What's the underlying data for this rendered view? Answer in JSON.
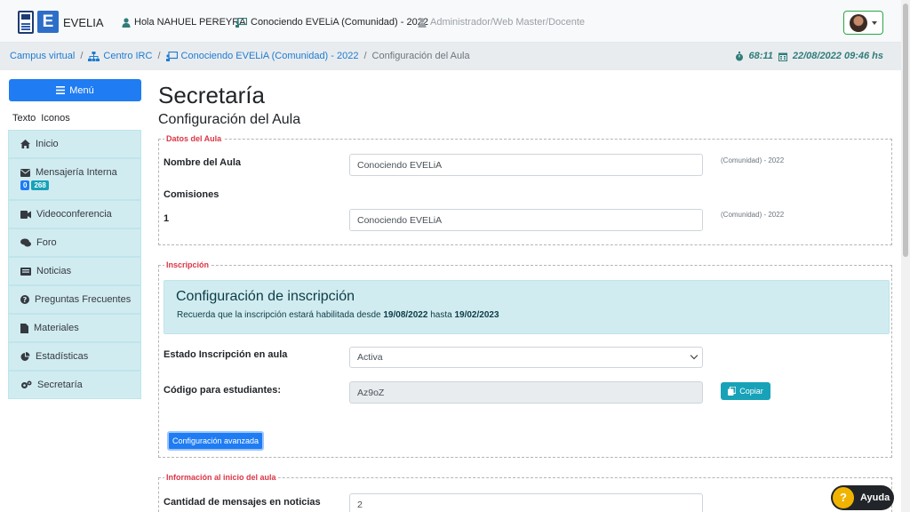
{
  "header": {
    "brand": "EVELIA",
    "logo_letter": "E",
    "greeting": "Hola NAHUEL PEREYRA",
    "course": "Conociendo EVELiA (Comunidad) - 2022",
    "role": "Administrador/Web Master/Docente"
  },
  "breadcrumb": {
    "items": [
      "Campus virtual",
      "Centro IRC",
      "Conociendo EVELiA (Comunidad) - 2022"
    ],
    "current": "Configuración del Aula",
    "separator": "/",
    "timer": "68:11",
    "datetime": "22/08/2022 09:46 hs"
  },
  "sidebar": {
    "menu_label": "Menú",
    "view_text": "Texto",
    "view_icons": "Iconos",
    "items": [
      {
        "label": "Inicio",
        "icon": "home-icon"
      },
      {
        "label": "Mensajería Interna",
        "icon": "envelope-icon",
        "badge_a": "0",
        "badge_b": "268"
      },
      {
        "label": "Videoconferencia",
        "icon": "video-icon"
      },
      {
        "label": "Foro",
        "icon": "comments-icon"
      },
      {
        "label": "Noticias",
        "icon": "newspaper-icon"
      },
      {
        "label": "Preguntas Frecuentes",
        "icon": "question-circle-icon"
      },
      {
        "label": "Materiales",
        "icon": "file-icon"
      },
      {
        "label": "Estadísticas",
        "icon": "pie-chart-icon"
      },
      {
        "label": "Secretaría",
        "icon": "cogs-icon"
      }
    ]
  },
  "main": {
    "title": "Secretaría",
    "subtitle": "Configuración del Aula",
    "datos": {
      "legend": "Datos del Aula",
      "name_label": "Nombre del Aula",
      "name_value": "Conociendo EVELiA",
      "name_hint": "(Comunidad) - 2022",
      "comisiones_label": "Comisiones",
      "com1_label": "1",
      "com1_value": "Conociendo EVELiA",
      "com1_hint": "(Comunidad) - 2022"
    },
    "inscripcion": {
      "legend": "Inscripción",
      "box_title": "Configuración de inscripción",
      "box_text_1": "Recuerda que la inscripción estará habilitada desde ",
      "date_from": "19/08/2022",
      "box_text_2": " hasta ",
      "date_to": "19/02/2023",
      "estado_label": "Estado Inscripción en aula",
      "estado_value": "Activa",
      "codigo_label": "Código para estudiantes:",
      "codigo_value": "Az9oZ",
      "copy_label": "Copiar",
      "advanced_label": "Configuración avanzada"
    },
    "info_inicio": {
      "legend": "Información al inicio del aula",
      "mensajes_label": "Cantidad de mensajes en noticias",
      "mensajes_value": "2"
    }
  },
  "help": {
    "label": "Ayuda",
    "icon_glyph": "?"
  },
  "colors": {
    "primary": "#1f7cf2",
    "info": "#17a2b8",
    "sidebar_bg": "#d1ecf1",
    "legend_red": "#dc3545",
    "clock": "#2f7d7a"
  }
}
